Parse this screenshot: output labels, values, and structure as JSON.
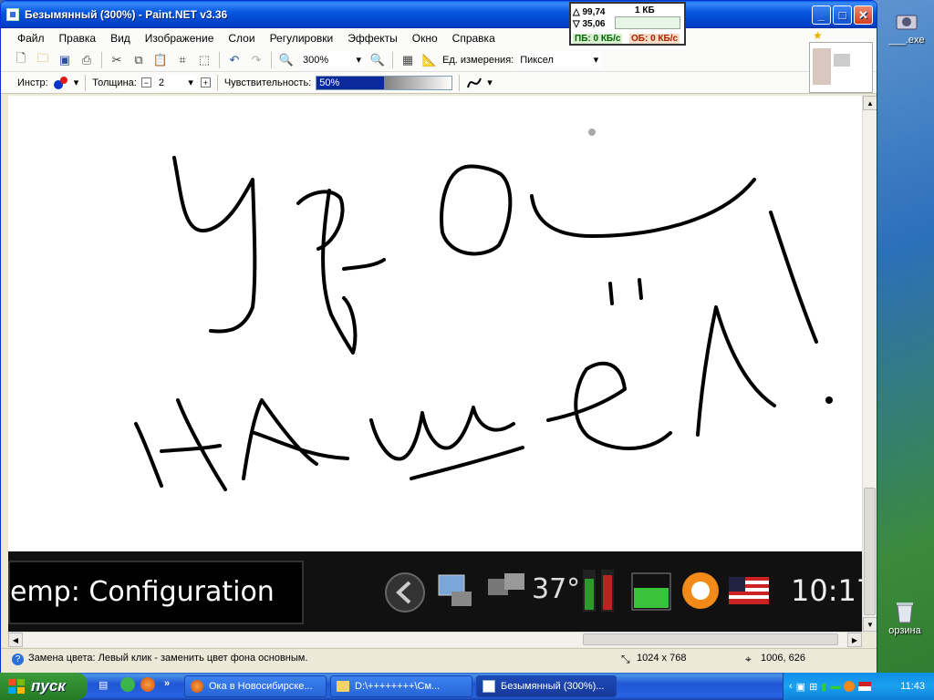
{
  "window": {
    "title": "Безымянный (300%) - Paint.NET v3.36",
    "minimize_glyph": "_",
    "maximize_glyph": "□",
    "close_glyph": "✕"
  },
  "menu": [
    "Файл",
    "Правка",
    "Вид",
    "Изображение",
    "Слои",
    "Регулировки",
    "Эффекты",
    "Окно",
    "Справка"
  ],
  "toolbar": {
    "zoom_value": "300%",
    "units_label": "Ед. измерения:",
    "units_value": "Пиксел"
  },
  "tool_options": {
    "tool_label": "Инстр:",
    "width_label": "Толщина:",
    "width_value": "2",
    "sensitivity_label": "Чувствительность:",
    "sensitivity_value": "50%",
    "sensitivity_level": 0.5
  },
  "netmeter": {
    "up": "△ 99,74",
    "down": "▽ 35,06",
    "scale": "1 КБ",
    "pb": "ПБ: 0 КБ/с",
    "ob": "ОБ: 0 КБ/с"
  },
  "embedded": {
    "config_text": "emp: Configuration",
    "temp": "37°",
    "clock": "10:17"
  },
  "statusbar": {
    "hint": "Замена цвета: Левый клик - заменить цвет фона основным.",
    "image_size": "1024 x 768",
    "cursor_pos": "1006, 626"
  },
  "desktop": {
    "icon_exe_label": "___.exe",
    "icon_recycle_label": "орзина"
  },
  "taskbar": {
    "start_label": "пуск",
    "tasks": [
      {
        "label": "Ока в Новосибирске..."
      },
      {
        "label": "D:\\++++++++\\См..."
      },
      {
        "label": "Безымянный (300%)..."
      }
    ],
    "clock": "11:43"
  },
  "colors": {
    "title_blue": "#0758e0",
    "taskbar_blue": "#2157d7",
    "start_green": "#2f8a2f",
    "slider_fill": "#0a2a9a"
  }
}
